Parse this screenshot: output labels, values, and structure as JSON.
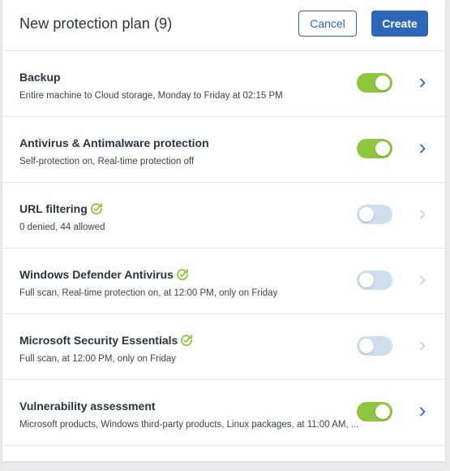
{
  "header": {
    "title": "New protection plan (9)",
    "cancel_label": "Cancel",
    "create_label": "Create"
  },
  "colors": {
    "primary": "#2f67b8",
    "toggle_on": "#8ec63f",
    "toggle_off": "#cfdff2",
    "chevron_active": "#2f67b8",
    "chevron_inactive": "#c9d3df",
    "badge": "#8ec63f"
  },
  "modules": [
    {
      "title": "Backup",
      "description": "Entire machine to Cloud storage, Monday to Friday at 02:15 PM",
      "enabled": true,
      "badge_icon": null
    },
    {
      "title": "Antivirus & Antimalware protection",
      "description": "Self-protection on, Real-time protection off",
      "enabled": true,
      "badge_icon": null
    },
    {
      "title": "URL filtering",
      "description": "0 denied, 44 allowed",
      "enabled": false,
      "badge_icon": "refresh-check-icon"
    },
    {
      "title": "Windows Defender Antivirus",
      "description": "Full scan, Real-time protection on, at 12:00 PM, only on Friday",
      "enabled": false,
      "badge_icon": "refresh-check-icon"
    },
    {
      "title": "Microsoft Security Essentials",
      "description": "Full scan, at 12:00 PM, only on Friday",
      "enabled": false,
      "badge_icon": "refresh-check-icon"
    },
    {
      "title": "Vulnerability assessment",
      "description": "Microsoft products, Windows third-party products, Linux packages, at 11:00 AM, ...",
      "enabled": true,
      "badge_icon": null
    }
  ]
}
